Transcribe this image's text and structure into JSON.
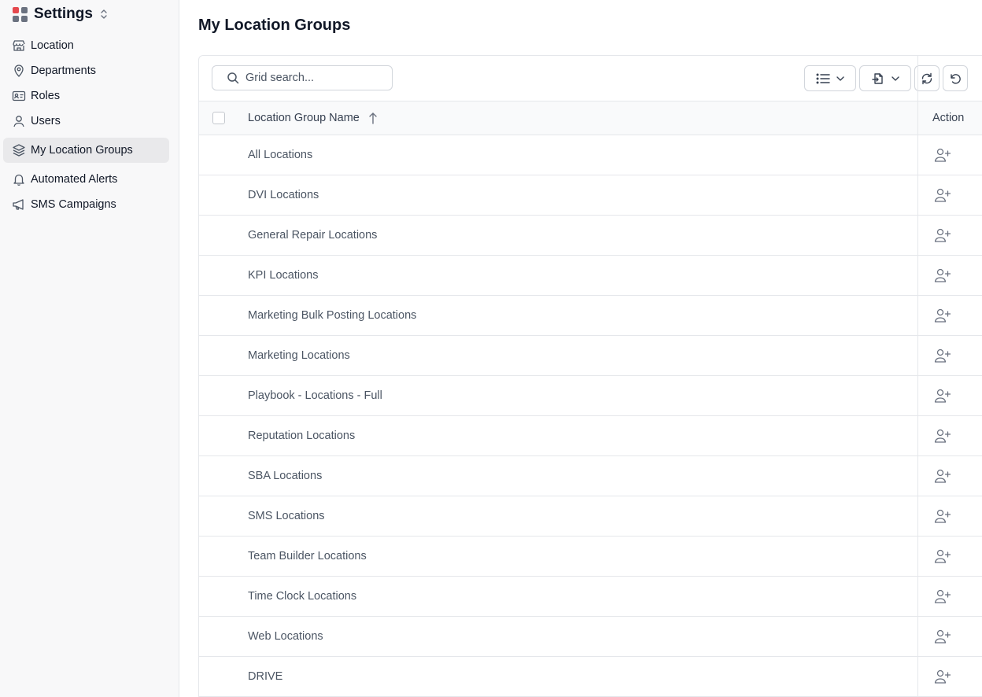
{
  "app": {
    "title": "Settings",
    "logo_colors": [
      "#e5484d",
      "#6b7280",
      "#6b7280",
      "#6b7280"
    ]
  },
  "sidebar": {
    "items": [
      {
        "label": "Location",
        "icon": "store-icon"
      },
      {
        "label": "Departments",
        "icon": "map-pin-icon"
      },
      {
        "label": "Roles",
        "icon": "id-card-icon"
      },
      {
        "label": "Users",
        "icon": "user-icon"
      },
      {
        "label": "My Location Groups",
        "icon": "layers-icon",
        "active": true
      },
      {
        "label": "Automated Alerts",
        "icon": "bell-icon"
      },
      {
        "label": "SMS Campaigns",
        "icon": "megaphone-icon"
      }
    ]
  },
  "main": {
    "title": "My Location Groups",
    "search": {
      "placeholder": "Grid search...",
      "value": ""
    },
    "toolbar": {
      "buttons": [
        "columns-menu-button",
        "export-menu-button",
        "refresh-button",
        "reset-button"
      ]
    },
    "grid": {
      "columns": [
        "Location Group Name",
        "Action"
      ],
      "sort": "ascending",
      "rows": [
        "All Locations",
        "DVI Locations",
        "General Repair Locations",
        "KPI Locations",
        "Marketing Bulk Posting Locations",
        "Marketing Locations",
        "Playbook - Locations - Full",
        "Reputation Locations",
        "SBA Locations",
        "SMS Locations",
        "Team Builder Locations",
        "Time Clock Locations",
        "Web Locations",
        "DRIVE"
      ],
      "row_action_icon": "user-plus-icon"
    }
  }
}
